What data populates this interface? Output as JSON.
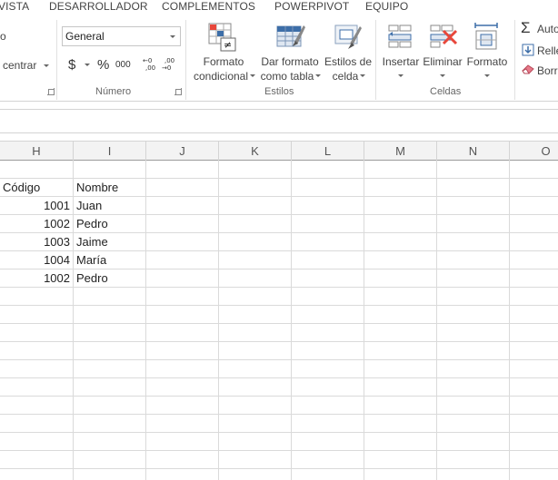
{
  "menu_tabs": [
    "VISTA",
    "DESARROLLADOR",
    "COMPLEMENTOS",
    "POWERPIVOT",
    "EQUIPO"
  ],
  "ribbon": {
    "alignment_partial": {
      "combine_label": "centrar",
      "o_label": "o"
    },
    "number": {
      "format_value": "General",
      "currency": "$",
      "percent": "%",
      "thousands": "000",
      "group_label": "Número"
    },
    "styles": {
      "conditional_format": [
        "Formato",
        "condicional"
      ],
      "table_format": [
        "Dar formato",
        "como tabla"
      ],
      "cell_styles": [
        "Estilos de",
        "celda"
      ],
      "group_label": "Estilos"
    },
    "cells": {
      "insert": "Insertar",
      "delete": "Eliminar",
      "format": "Formato",
      "group_label": "Celdas"
    },
    "editing": {
      "autosum": "Auto",
      "fill": "Relle",
      "clear": "Borr"
    }
  },
  "sheet": {
    "columns": [
      "H",
      "I",
      "J",
      "K",
      "L",
      "M",
      "N",
      "O"
    ],
    "headers": {
      "codigo": "Código",
      "nombre": "Nombre"
    },
    "rows": [
      {
        "codigo": "1001",
        "nombre": "Juan"
      },
      {
        "codigo": "1002",
        "nombre": "Pedro"
      },
      {
        "codigo": "1003",
        "nombre": "Jaime"
      },
      {
        "codigo": "1004",
        "nombre": "María"
      },
      {
        "codigo": "1002",
        "nombre": "Pedro"
      }
    ]
  },
  "colors": {
    "accent_red": "#e8473b",
    "icon_blue": "#3d6ea8",
    "grid_line": "#dadada"
  }
}
